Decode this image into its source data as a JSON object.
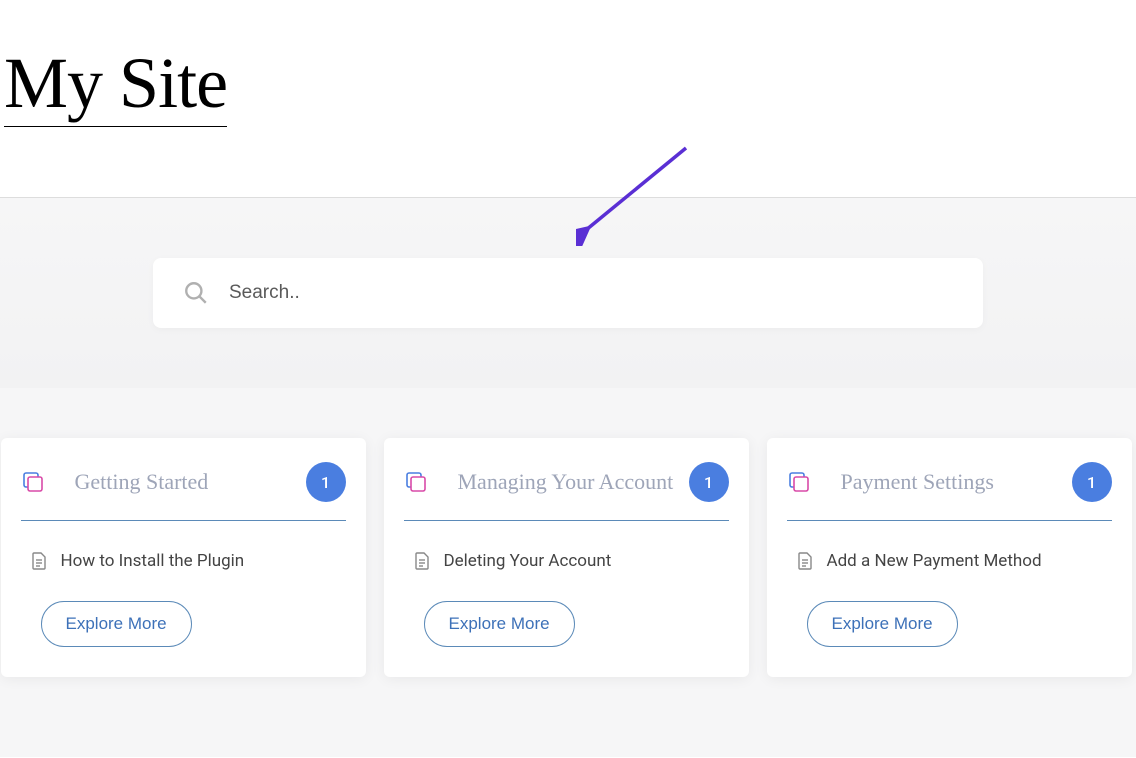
{
  "site_title": "My Site",
  "search": {
    "placeholder": "Search.."
  },
  "cards": [
    {
      "title": "Getting Started",
      "count": "1",
      "article": "How to Install the Plugin",
      "cta": "Explore More"
    },
    {
      "title": "Managing Your Account",
      "count": "1",
      "article": "Deleting Your Account",
      "cta": "Explore More"
    },
    {
      "title": "Payment Settings",
      "count": "1",
      "article": "Add a New Payment Method",
      "cta": "Explore More"
    }
  ],
  "colors": {
    "accent_blue": "#4a7ee0",
    "arrow_purple": "#5a2fd4",
    "title_muted": "#9ea5b8",
    "border_blue": "#5b8ab8"
  }
}
